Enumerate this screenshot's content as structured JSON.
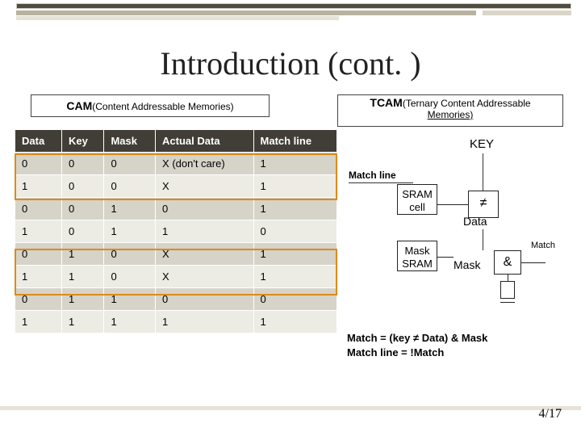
{
  "slide": {
    "title": "Introduction (cont. )",
    "page_number": "4/17"
  },
  "subheads": {
    "cam_main": "CAM",
    "cam_sub": "(Content Addressable Memories)",
    "tcam_main": "TCAM",
    "tcam_sub": "(Ternary Content Addressable",
    "tcam_sub2": "Memories)"
  },
  "table": {
    "headers": [
      "Data",
      "Key",
      "Mask",
      "Actual Data",
      "Match line"
    ],
    "rows": [
      [
        "0",
        "0",
        "0",
        "X (don't care)",
        "1"
      ],
      [
        "1",
        "0",
        "0",
        "X",
        "1"
      ],
      [
        "0",
        "0",
        "1",
        "0",
        "1"
      ],
      [
        "1",
        "0",
        "1",
        "1",
        "0"
      ],
      [
        "0",
        "1",
        "0",
        "X",
        "1"
      ],
      [
        "1",
        "1",
        "0",
        "X",
        "1"
      ],
      [
        "0",
        "1",
        "1",
        "0",
        "0"
      ],
      [
        "1",
        "1",
        "1",
        "1",
        "1"
      ]
    ]
  },
  "diagram": {
    "key": "KEY",
    "matchline": "Match line",
    "sram": "SRAM\ncell",
    "mask": "Mask\nSRAM",
    "neq": "≠",
    "and": "&",
    "data": "Data",
    "mask_label": "Mask",
    "match": "Match"
  },
  "equations": {
    "eq1": "Match = (key ≠ Data) & Mask",
    "eq2": "Match line = !Match"
  }
}
